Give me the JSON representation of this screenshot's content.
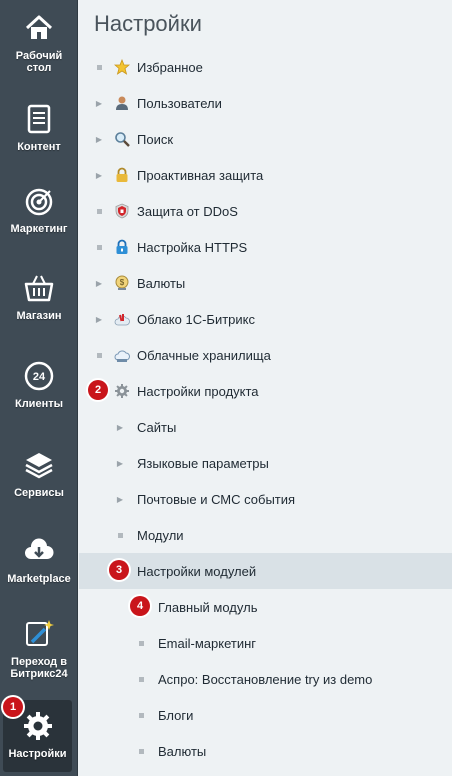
{
  "sidebar": {
    "items": [
      {
        "label": "Рабочий стол",
        "icon": "home-icon"
      },
      {
        "label": "Контент",
        "icon": "document-icon"
      },
      {
        "label": "Маркетинг",
        "icon": "target-icon"
      },
      {
        "label": "Магазин",
        "icon": "basket-icon"
      },
      {
        "label": "Клиенты",
        "icon": "clock-24-icon"
      },
      {
        "label": "Сервисы",
        "icon": "layers-icon"
      },
      {
        "label": "Marketplace",
        "icon": "cloud-download-icon"
      },
      {
        "label": "Переход в Битрикс24",
        "icon": "magic-wand-icon"
      },
      {
        "label": "Настройки",
        "icon": "gear-icon"
      }
    ]
  },
  "main": {
    "title": "Настройки",
    "tree": [
      {
        "label": "Избранное",
        "marker": "dot",
        "icon": "star-icon"
      },
      {
        "label": "Пользователи",
        "marker": "arrow",
        "icon": "user-icon"
      },
      {
        "label": "Поиск",
        "marker": "arrow",
        "icon": "magnifier-icon"
      },
      {
        "label": "Проактивная защита",
        "marker": "arrow",
        "icon": "padlock-icon"
      },
      {
        "label": "Защита от DDoS",
        "marker": "dot",
        "icon": "shield-icon"
      },
      {
        "label": "Настройка HTTPS",
        "marker": "dot",
        "icon": "https-lock-icon"
      },
      {
        "label": "Валюты",
        "marker": "arrow",
        "icon": "currency-icon"
      },
      {
        "label": "Облако 1С-Битрикс",
        "marker": "arrow",
        "icon": "cloud-icon"
      },
      {
        "label": "Облачные хранилища",
        "marker": "dot",
        "icon": "cloud-storage-icon"
      },
      {
        "label": "Настройки продукта",
        "marker": "none",
        "icon": "gear-icon"
      },
      {
        "label": "Сайты",
        "marker": "arrow"
      },
      {
        "label": "Языковые параметры",
        "marker": "arrow"
      },
      {
        "label": "Почтовые и СМС события",
        "marker": "arrow"
      },
      {
        "label": "Модули",
        "marker": "dot"
      },
      {
        "label": "Настройки модулей",
        "marker": "none"
      },
      {
        "label": "Главный модуль",
        "marker": "none"
      },
      {
        "label": "Email-маркетинг",
        "marker": "dot"
      },
      {
        "label": "Аспро: Восстановление try из demo",
        "marker": "dot"
      },
      {
        "label": "Блоги",
        "marker": "dot"
      },
      {
        "label": "Валюты",
        "marker": "dot"
      }
    ]
  },
  "badges": [
    "1",
    "2",
    "3",
    "4"
  ],
  "colors": {
    "rail": "#3f4b55",
    "selected_row": "#d9e1e6",
    "badge": "#c9151b"
  }
}
